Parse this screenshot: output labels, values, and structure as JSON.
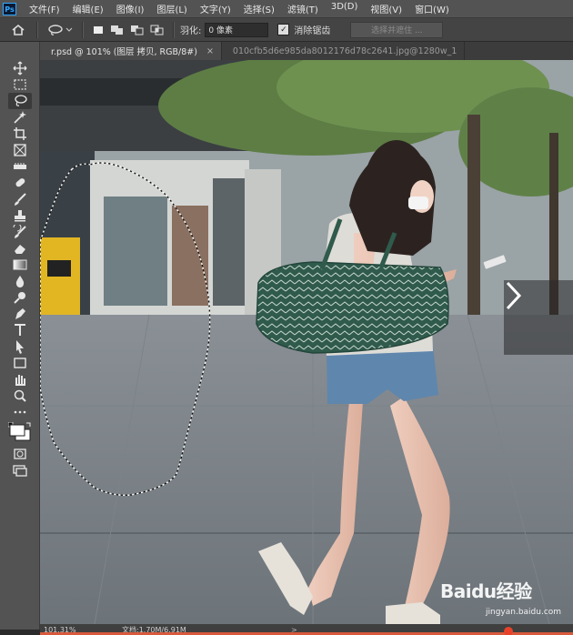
{
  "app": {
    "logo": "Ps"
  },
  "menu": [
    "文件(F)",
    "编辑(E)",
    "图像(I)",
    "图层(L)",
    "文字(Y)",
    "选择(S)",
    "滤镜(T)",
    "3D(D)",
    "视图(V)",
    "窗口(W)"
  ],
  "options": {
    "feather_label": "羽化:",
    "feather_value": "0 像素",
    "antialias_label": "消除锯齿",
    "antialias_checked": true,
    "select_mask_label": "选择并遮住 ..."
  },
  "tabs": [
    {
      "label": "r.psd @ 101% (图层 拷贝, RGB/8#)",
      "close": "×",
      "active": true
    },
    {
      "label": "010cfb5d6e985da8012176d78c2641.jpg@1280w_1",
      "active": false
    }
  ],
  "status": {
    "zoom": "101.31%",
    "doc": "文档:1.70M/6.91M",
    "arrow": ">"
  },
  "watermark": {
    "logo": "Baidu经验",
    "url": "jingyan.baidu.com"
  },
  "icons": {
    "toolbar": [
      "move-icon",
      "marquee-icon",
      "lasso-icon",
      "magic-wand-icon",
      "crop-icon",
      "frame-icon",
      "eyedropper-icon",
      "healing-brush-icon",
      "brush-icon",
      "clone-stamp-icon",
      "history-brush-icon",
      "eraser-icon",
      "gradient-icon",
      "blur-icon",
      "dodge-icon",
      "pen-icon",
      "type-icon",
      "path-selection-icon",
      "rectangle-icon",
      "hand-icon",
      "zoom-icon",
      "more-tools-icon",
      "color-swatches-icon",
      "quick-mask-icon",
      "screen-mode-icon"
    ]
  },
  "colors": {
    "accent": "#31a8ff",
    "scroll": "#d85a3c"
  }
}
